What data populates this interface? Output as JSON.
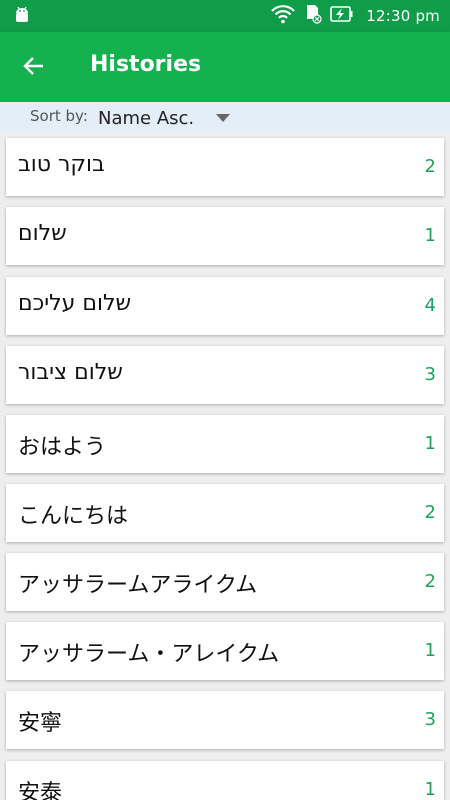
{
  "status_bar": {
    "time": "12:30 pm",
    "icons": [
      "android-icon",
      "wifi-icon",
      "sd-card-icon",
      "battery-charging-icon"
    ]
  },
  "app_bar": {
    "title": "Histories",
    "back_icon": "arrow-left-icon"
  },
  "sort": {
    "label": "Sort by:",
    "value": "Name Asc."
  },
  "colors": {
    "status_bar": "#0f9d4a",
    "app_bar": "#14b14f",
    "sort_bar": "#e3eef9",
    "count": "#1aa35a"
  },
  "items": [
    {
      "text": "בוקר טוב",
      "count": "2"
    },
    {
      "text": "שלום",
      "count": "1"
    },
    {
      "text": "שלום עליכם",
      "count": "4"
    },
    {
      "text": "שלום ציבור",
      "count": "3"
    },
    {
      "text": "おはよう",
      "count": "1"
    },
    {
      "text": "こんにちは",
      "count": "2"
    },
    {
      "text": "アッサラームアライクム",
      "count": "2"
    },
    {
      "text": "アッサラーム・アレイクム",
      "count": "1"
    },
    {
      "text": "安寧",
      "count": "3"
    },
    {
      "text": "安泰",
      "count": "1"
    }
  ]
}
